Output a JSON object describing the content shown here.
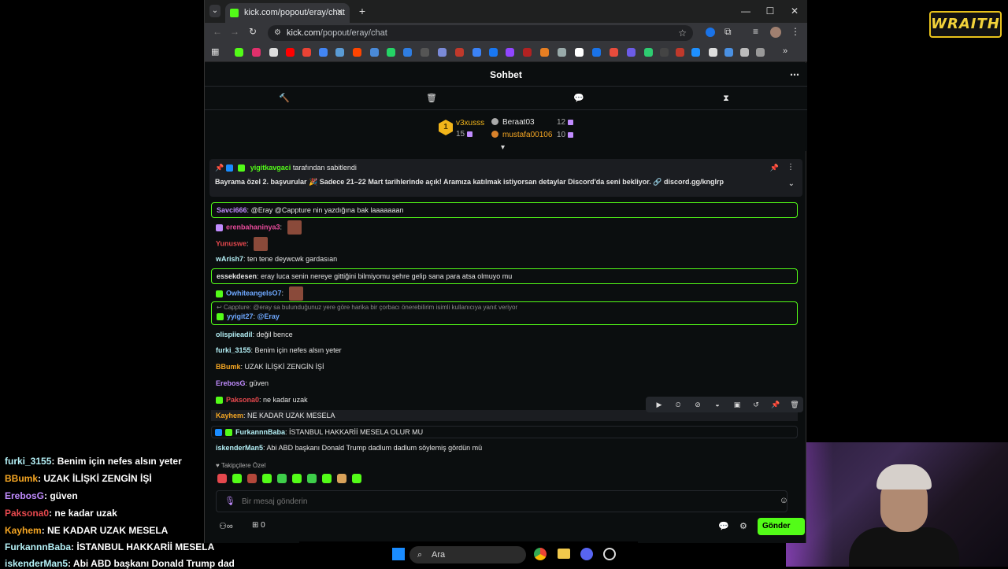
{
  "browser": {
    "tab_title": "kick.com/popout/eray/chat",
    "url_host": "kick.com",
    "url_path": "/popout/eray/chat"
  },
  "chat": {
    "title": "Sohbet",
    "leaderboard": {
      "first": {
        "name": "v3xusss",
        "count": "15"
      },
      "second": {
        "name": "Beraat03",
        "count": "12"
      },
      "third": {
        "name": "mustafa00106",
        "count": "10"
      }
    },
    "pinned": {
      "pinned_by": "yigitkavgaci",
      "pinned_by_suffix": "tarafından sabitlendi",
      "text": "Bayrama özel 2. başvurular 🎉 Sadece 21–22 Mart tarihlerinde açık! Aramıza katılmak istiyorsan detaylar Discord'da seni bekliyor. 🔗 discord.gg/knglrp"
    },
    "messages": [
      {
        "user": "Savci666",
        "text": "@Eray @Cappture nin yazdığına bak laaaaaaan",
        "color": "#c18cff"
      },
      {
        "user": "erenbahaninya3",
        "text": "",
        "color": "#e54a9a"
      },
      {
        "user": "Yunuswe",
        "text": "",
        "color": "#e5484d"
      },
      {
        "user": "wArish7",
        "text": "ten tene deywcwk gardasıan",
        "color": "#b4f0f6"
      },
      {
        "user": "essekdesen",
        "text": "eray luca senin nereye gittiğini bilmiyomu şehre gelip sana para atsa olmuyo mu",
        "color": "#e6e6e6"
      },
      {
        "user": "OwhiteangelsO7",
        "text": "",
        "color": "#6ea8ff"
      },
      {
        "reply_to": "Cappture: @eray sa bulunduğunuz yere göre harika bir çorbacı önerebilirim isimli kullanıcıya yanıt veriyor",
        "user": "yyigit27",
        "text": "@Eray",
        "color": "#6ea8ff"
      },
      {
        "user": "olispiieadil",
        "text": "değil bence",
        "color": "#b4f0f6"
      },
      {
        "user": "furki_3155",
        "text": "Benim için nefes alsın yeter",
        "color": "#b4f0f6"
      },
      {
        "user": "BBumk",
        "text": "UZAK İLİŞKİ ZENGİN İŞİ",
        "color": "#f5a623"
      },
      {
        "user": "ErebosG",
        "text": "güven",
        "color": "#c18cff"
      },
      {
        "user": "Paksona0",
        "text": "ne kadar uzak",
        "color": "#e5484d"
      },
      {
        "user": "Kayhem",
        "text": "NE KADAR UZAK MESELA",
        "color": "#f5a623"
      },
      {
        "user": "FurkannnBaba",
        "text": "İSTANBUL HAKKARİİ MESELA OLUR MU",
        "color": "#b4f0f6"
      },
      {
        "user": "iskenderMan5",
        "text": "Abi ABD başkanı Donald Trump dadlum dadlum söylemiş gördün mü",
        "color": "#b4f0f6"
      }
    ],
    "emote_section_label": "Takipçilere Özel",
    "input_placeholder": "Bir mesaj gönderin",
    "send_label": "Gönder",
    "viewer_count": "0"
  },
  "overlay": {
    "logo": "WRAITH",
    "lines": [
      {
        "user": "furki_3155",
        "text": ": Benim için nefes alsın yeter",
        "color": "#b4f0f6"
      },
      {
        "user": "BBumk",
        "text": ": UZAK İLİŞKİ ZENGİN İŞİ",
        "color": "#f5a623"
      },
      {
        "user": "ErebosG",
        "text": ": güven",
        "color": "#c18cff"
      },
      {
        "user": "Paksona0",
        "text": ": ne kadar uzak",
        "color": "#e5484d"
      },
      {
        "user": "Kayhem",
        "text": ": NE KADAR UZAK MESELA",
        "color": "#f5a623"
      },
      {
        "user": "FurkannnBaba",
        "text": ": İSTANBUL HAKKARİİ MESELA",
        "color": "#b4f0f6"
      },
      {
        "user": "iskenderMan5",
        "text": ": Abi ABD başkanı Donald Trump dad",
        "color": "#b4f0f6"
      }
    ]
  },
  "taskbar": {
    "search_label": "Ara"
  },
  "colors": {
    "kick_green": "#53fc18",
    "background": "#0b0e0f"
  }
}
